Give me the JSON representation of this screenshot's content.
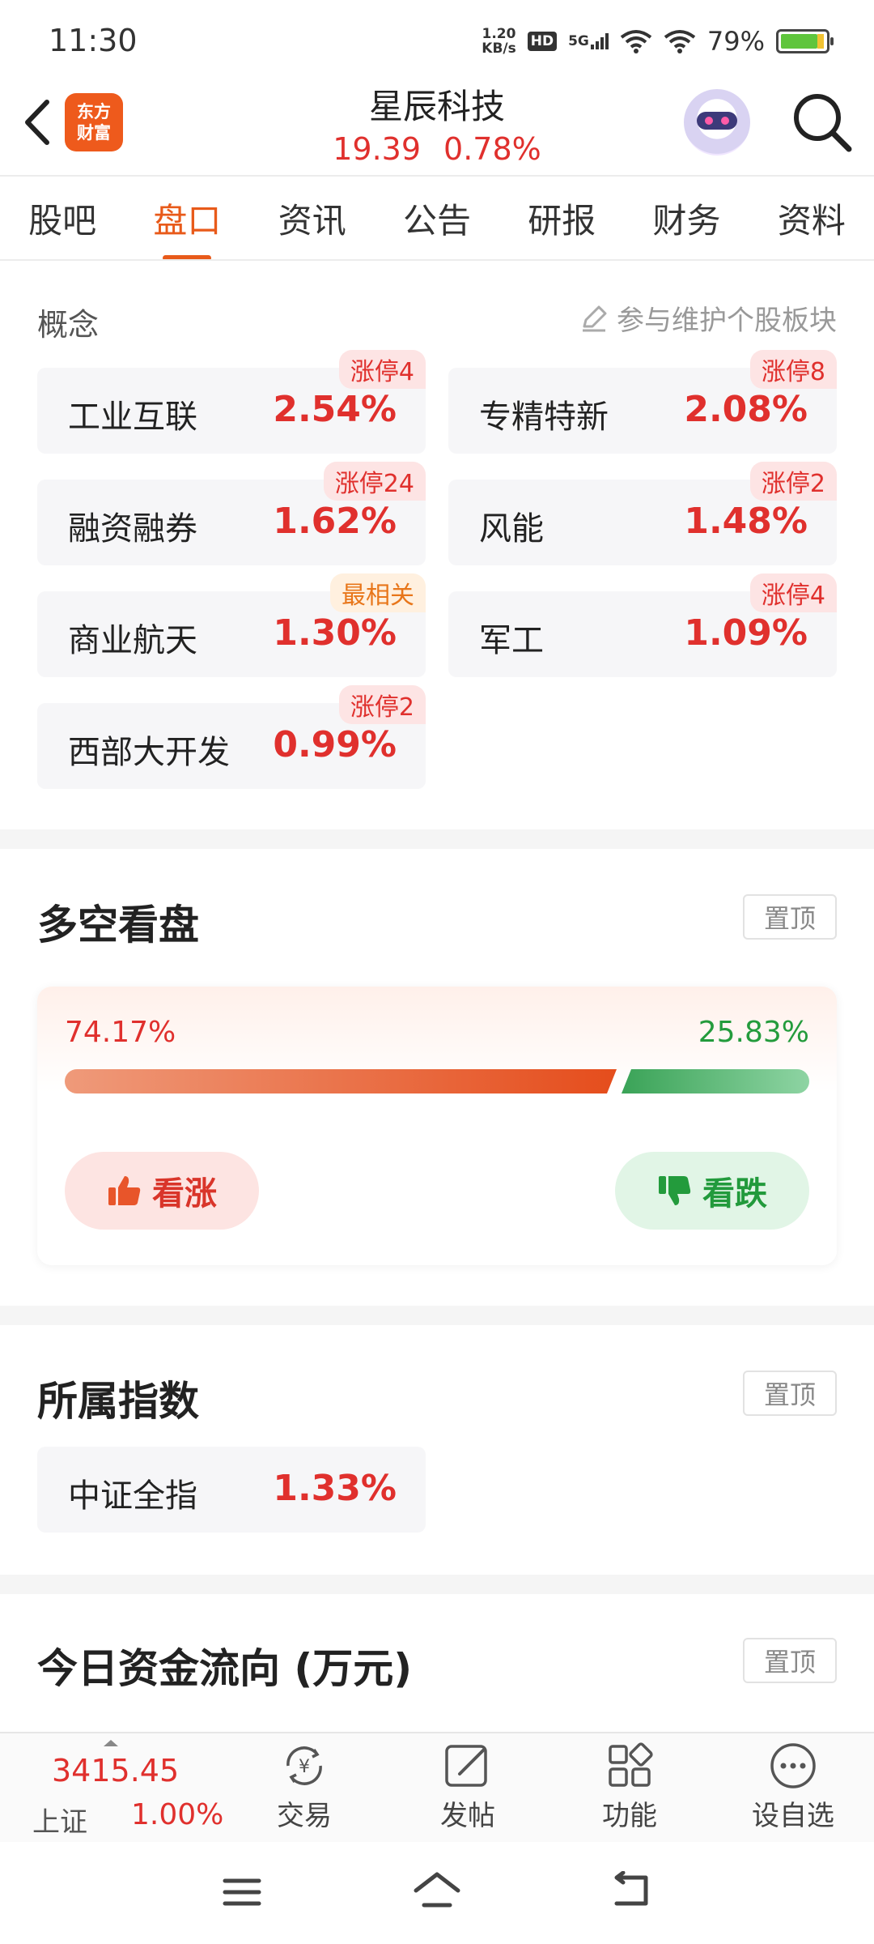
{
  "status_bar": {
    "time": "11:30",
    "net_speed_value": "1.20",
    "net_speed_unit": "KB/s",
    "hd": "HD",
    "signal": "5G",
    "battery": "79%"
  },
  "header": {
    "logo_text_line1": "东方",
    "logo_text_line2": "财富",
    "stock_name": "星辰科技",
    "price": "19.39",
    "change_pct": "0.78%"
  },
  "tabs": [
    {
      "label": "股吧"
    },
    {
      "label": "盘口"
    },
    {
      "label": "资讯"
    },
    {
      "label": "公告"
    },
    {
      "label": "研报"
    },
    {
      "label": "财务"
    },
    {
      "label": "资料"
    }
  ],
  "concepts": {
    "title": "概念",
    "maintain_link": "参与维护个股板块",
    "items": [
      {
        "name": "工业互联",
        "pct": "2.54%",
        "badge": "涨停4"
      },
      {
        "name": "专精特新",
        "pct": "2.08%",
        "badge": "涨停8"
      },
      {
        "name": "融资融券",
        "pct": "1.62%",
        "badge": "涨停24"
      },
      {
        "name": "风能",
        "pct": "1.48%",
        "badge": "涨停2"
      },
      {
        "name": "商业航天",
        "pct": "1.30%",
        "badge": "最相关"
      },
      {
        "name": "军工",
        "pct": "1.09%",
        "badge": "涨停4"
      },
      {
        "name": "西部大开发",
        "pct": "0.99%",
        "badge": "涨停2"
      }
    ]
  },
  "sentiment": {
    "title": "多空看盘",
    "pin_label": "置顶",
    "bull_pct": "74.17%",
    "bear_pct": "25.83%",
    "bull_fraction": 0.7417,
    "bull_label": "看涨",
    "bear_label": "看跌"
  },
  "index_section": {
    "title": "所属指数",
    "pin_label": "置顶",
    "items": [
      {
        "name": "中证全指",
        "pct": "1.33%"
      }
    ]
  },
  "fund_flow": {
    "title": "今日资金流向 (万元)",
    "pin_label": "置顶"
  },
  "bottom_bar": {
    "index_value": "3415.45",
    "index_name": "上证",
    "index_pct": "1.00%",
    "items": [
      {
        "label": "交易",
        "icon": "trade-yen-icon"
      },
      {
        "label": "发帖",
        "icon": "post-edit-icon"
      },
      {
        "label": "功能",
        "icon": "grid-icon"
      },
      {
        "label": "设自选",
        "icon": "more-dots-icon"
      }
    ]
  },
  "colors": {
    "up_red": "#e0302d",
    "down_green": "#239b3c",
    "accent_orange": "#e85a1a"
  }
}
